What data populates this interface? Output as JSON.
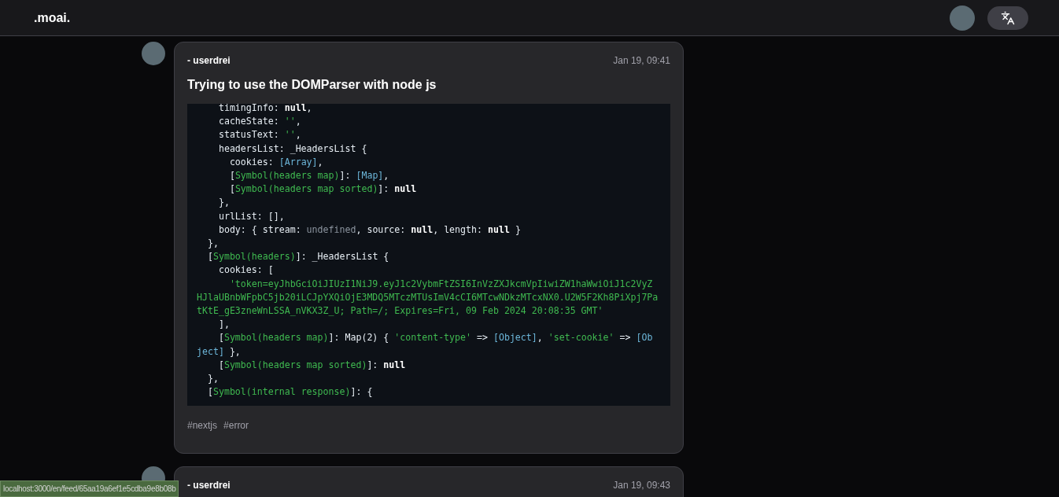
{
  "header": {
    "logo": ".moai."
  },
  "posts": [
    {
      "author": "- userdrei",
      "time": "Jan 19, 09:41",
      "title": "Trying to use the DOMParser with node js",
      "code": [
        [
          {
            "kind": "p",
            "text": "    timingInfo: "
          },
          {
            "kind": "k",
            "text": "null"
          },
          {
            "kind": "p",
            "text": ","
          }
        ],
        [
          {
            "kind": "p",
            "text": "    cacheState: "
          },
          {
            "kind": "s",
            "text": "''"
          },
          {
            "kind": "p",
            "text": ","
          }
        ],
        [
          {
            "kind": "p",
            "text": "    statusText: "
          },
          {
            "kind": "s",
            "text": "''"
          },
          {
            "kind": "p",
            "text": ","
          }
        ],
        [
          {
            "kind": "p",
            "text": "    headersList: _HeadersList {"
          }
        ],
        [
          {
            "kind": "p",
            "text": "      cookies: "
          },
          {
            "kind": "t",
            "text": "[Array]"
          },
          {
            "kind": "p",
            "text": ","
          }
        ],
        [
          {
            "kind": "p",
            "text": "      ["
          },
          {
            "kind": "s",
            "text": "Symbol(headers map)"
          },
          {
            "kind": "p",
            "text": "]: "
          },
          {
            "kind": "t",
            "text": "[Map]"
          },
          {
            "kind": "p",
            "text": ","
          }
        ],
        [
          {
            "kind": "p",
            "text": "      ["
          },
          {
            "kind": "s",
            "text": "Symbol(headers map sorted)"
          },
          {
            "kind": "p",
            "text": "]: "
          },
          {
            "kind": "k",
            "text": "null"
          }
        ],
        [
          {
            "kind": "p",
            "text": "    },"
          }
        ],
        [
          {
            "kind": "p",
            "text": "    urlList: [],"
          }
        ],
        [
          {
            "kind": "p",
            "text": "    body: { stream: "
          },
          {
            "kind": "u",
            "text": "undefined"
          },
          {
            "kind": "p",
            "text": ", source: "
          },
          {
            "kind": "k",
            "text": "null"
          },
          {
            "kind": "p",
            "text": ", length: "
          },
          {
            "kind": "k",
            "text": "null"
          },
          {
            "kind": "p",
            "text": " }"
          }
        ],
        [
          {
            "kind": "p",
            "text": "  },"
          }
        ],
        [
          {
            "kind": "p",
            "text": "  ["
          },
          {
            "kind": "s",
            "text": "Symbol(headers)"
          },
          {
            "kind": "p",
            "text": "]: _HeadersList {"
          }
        ],
        [
          {
            "kind": "p",
            "text": "    cookies: ["
          }
        ],
        [
          {
            "kind": "s",
            "text": "      'token=eyJhbGciOiJIUzI1NiJ9.eyJ1c2VybmFtZSI6InVzZXJkcmVpIiwiZW1haWwiOiJ1c2VyZHJlaUBnbWFpbC5jb20iLCJpYXQiOjE3MDQ5MTczMTUsImV4cCI6MTcwNDkzMTcxNX0.U2W5F2Kh8PiXpj7PatKtE_gE3zneWnLSSA_nVKX3Z_U; Path=/; Expires=Fri, 09 Feb 2024 20:08:35 GMT'"
          }
        ],
        [
          {
            "kind": "p",
            "text": "    ],"
          }
        ],
        [
          {
            "kind": "p",
            "text": "    ["
          },
          {
            "kind": "s",
            "text": "Symbol(headers map)"
          },
          {
            "kind": "p",
            "text": "]: Map(2) { "
          },
          {
            "kind": "s",
            "text": "'content-type'"
          },
          {
            "kind": "p",
            "text": " => "
          },
          {
            "kind": "t",
            "text": "[Object]"
          },
          {
            "kind": "p",
            "text": ", "
          },
          {
            "kind": "s",
            "text": "'set-cookie'"
          },
          {
            "kind": "p",
            "text": " => "
          },
          {
            "kind": "t",
            "text": "[Object]"
          },
          {
            "kind": "p",
            "text": " },"
          }
        ],
        [
          {
            "kind": "p",
            "text": "    ["
          },
          {
            "kind": "s",
            "text": "Symbol(headers map sorted)"
          },
          {
            "kind": "p",
            "text": "]: "
          },
          {
            "kind": "k",
            "text": "null"
          }
        ],
        [
          {
            "kind": "p",
            "text": "  },"
          }
        ],
        [
          {
            "kind": "p",
            "text": "  ["
          },
          {
            "kind": "s",
            "text": "Symbol(internal response)"
          },
          {
            "kind": "p",
            "text": "]: {"
          }
        ]
      ],
      "tags": [
        "#nextjs",
        "#error"
      ]
    },
    {
      "author": "- userdrei",
      "time": "Jan 19, 09:43"
    }
  ],
  "status_bar": {
    "url": "localhost:3000/en/feed/65aa19a6ef1e5cdba9e8b08b"
  }
}
